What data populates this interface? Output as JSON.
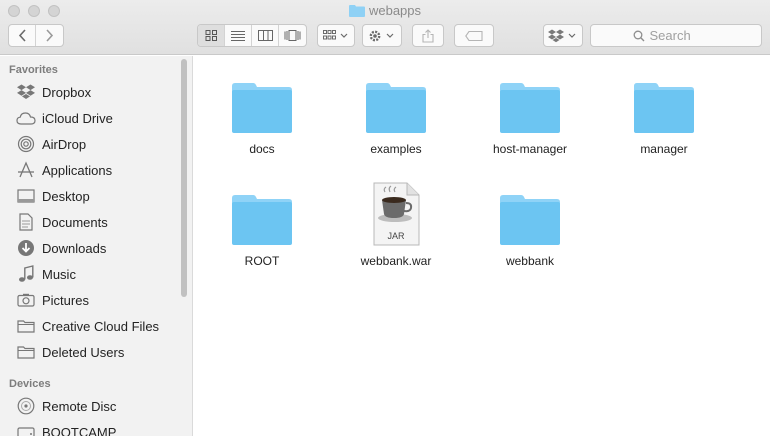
{
  "window": {
    "title": "webapps"
  },
  "toolbar": {
    "search_placeholder": "Search"
  },
  "sidebar": {
    "favorites_title": "Favorites",
    "favorites": [
      {
        "label": "Dropbox",
        "icon": "dropbox-icon"
      },
      {
        "label": "iCloud Drive",
        "icon": "cloud-icon"
      },
      {
        "label": "AirDrop",
        "icon": "airdrop-icon"
      },
      {
        "label": "Applications",
        "icon": "applications-icon"
      },
      {
        "label": "Desktop",
        "icon": "desktop-icon"
      },
      {
        "label": "Documents",
        "icon": "documents-icon"
      },
      {
        "label": "Downloads",
        "icon": "downloads-icon"
      },
      {
        "label": "Music",
        "icon": "music-icon"
      },
      {
        "label": "Pictures",
        "icon": "pictures-icon"
      },
      {
        "label": "Creative Cloud Files",
        "icon": "folder-icon"
      },
      {
        "label": "Deleted Users",
        "icon": "folder-icon"
      }
    ],
    "devices_title": "Devices",
    "devices": [
      {
        "label": "Remote Disc",
        "icon": "disc-icon"
      },
      {
        "label": "BOOTCAMP",
        "icon": "drive-icon"
      }
    ]
  },
  "files": [
    {
      "name": "docs",
      "type": "folder"
    },
    {
      "name": "examples",
      "type": "folder"
    },
    {
      "name": "host-manager",
      "type": "folder"
    },
    {
      "name": "manager",
      "type": "folder"
    },
    {
      "name": "ROOT",
      "type": "folder"
    },
    {
      "name": "webbank.war",
      "type": "jar",
      "badge": "JAR"
    },
    {
      "name": "webbank",
      "type": "folder"
    }
  ],
  "colors": {
    "folder": "#6cc5f2",
    "folder_tab": "#8fd3f7",
    "accent": "#5aa9e6"
  }
}
